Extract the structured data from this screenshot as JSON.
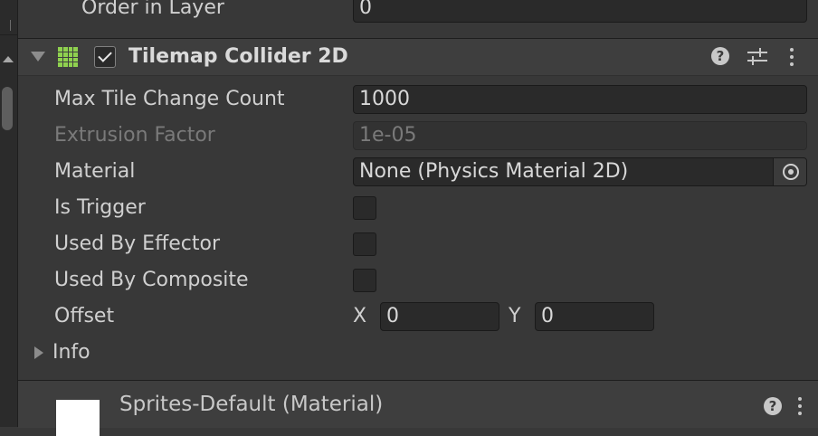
{
  "top_row": {
    "label": "Order in Layer",
    "value": "0"
  },
  "component": {
    "title": "Tilemap Collider 2D",
    "enabled": true,
    "icons": {
      "component": "tilemap-grid-icon",
      "help": "help-icon",
      "presets": "presets-icon",
      "menu": "kebab-icon"
    },
    "accent_color": "#8fd14f"
  },
  "fields": {
    "max_tile_change_count": {
      "label": "Max Tile Change Count",
      "value": "1000"
    },
    "extrusion_factor": {
      "label": "Extrusion Factor",
      "value": "1e-05"
    },
    "material": {
      "label": "Material",
      "value": "None (Physics Material 2D)"
    },
    "is_trigger": {
      "label": "Is Trigger",
      "checked": false
    },
    "used_by_effector": {
      "label": "Used By Effector",
      "checked": false
    },
    "used_by_composite": {
      "label": "Used By Composite",
      "checked": false
    },
    "offset": {
      "label": "Offset",
      "x_label": "X",
      "x": "0",
      "y_label": "Y",
      "y": "0"
    },
    "info": {
      "label": "Info"
    }
  },
  "material_section": {
    "title": "Sprites-Default (Material)",
    "help_symbol": "?"
  },
  "help_symbol": "?"
}
